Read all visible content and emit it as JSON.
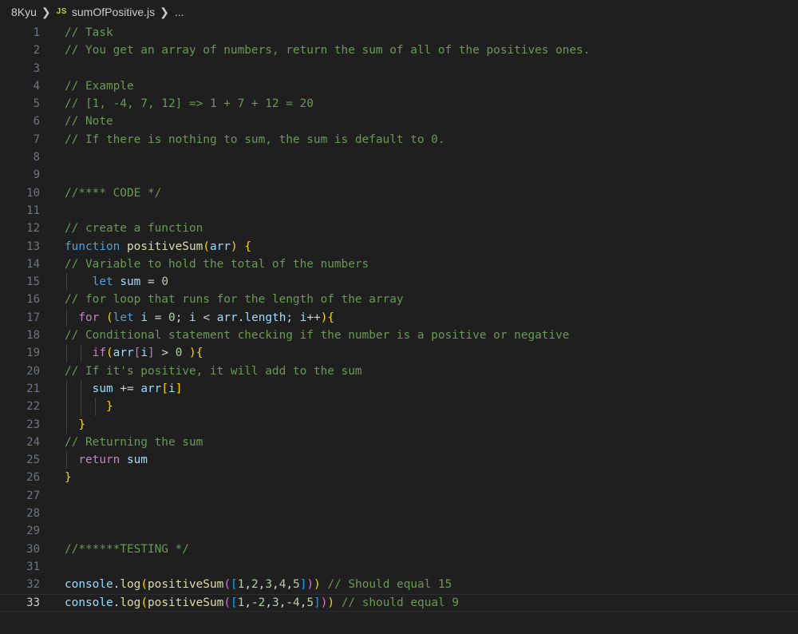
{
  "breadcrumb": {
    "folder": "8Kyu",
    "file_icon": "JS",
    "file_icon_color": "#cbcb41",
    "file": "sumOfPositive.js",
    "ellipsis": "..."
  },
  "editor": {
    "active_line": 33,
    "lines": [
      {
        "n": "1",
        "text": "// Task"
      },
      {
        "n": "2",
        "text": "// You get an array of numbers, return the sum of all of the positives ones."
      },
      {
        "n": "3",
        "text": ""
      },
      {
        "n": "4",
        "text": "// Example"
      },
      {
        "n": "5",
        "text": "// [1, -4, 7, 12] => 1 + 7 + 12 = 20"
      },
      {
        "n": "6",
        "text": "// Note"
      },
      {
        "n": "7",
        "text": "// If there is nothing to sum, the sum is default to 0."
      },
      {
        "n": "8",
        "text": ""
      },
      {
        "n": "9",
        "text": ""
      },
      {
        "n": "10",
        "text": "//**** CODE */"
      },
      {
        "n": "11",
        "text": ""
      },
      {
        "n": "12",
        "text": "// create a function"
      },
      {
        "n": "13",
        "text": "function positiveSum(arr) {"
      },
      {
        "n": "14",
        "text": "// Variable to hold the total of the numbers"
      },
      {
        "n": "15",
        "text": "    let sum = 0"
      },
      {
        "n": "16",
        "text": "// for loop that runs for the length of the array"
      },
      {
        "n": "17",
        "text": "  for (let i = 0; i < arr.length; i++){"
      },
      {
        "n": "18",
        "text": "// Conditional statement checking if the number is a positive or negative"
      },
      {
        "n": "19",
        "text": "    if(arr[i] > 0 ){"
      },
      {
        "n": "20",
        "text": "// If it's positive, it will add to the sum"
      },
      {
        "n": "21",
        "text": "    sum += arr[i]"
      },
      {
        "n": "22",
        "text": "      }"
      },
      {
        "n": "23",
        "text": "  }"
      },
      {
        "n": "24",
        "text": "// Returning the sum"
      },
      {
        "n": "25",
        "text": "  return sum"
      },
      {
        "n": "26",
        "text": "}"
      },
      {
        "n": "27",
        "text": ""
      },
      {
        "n": "28",
        "text": ""
      },
      {
        "n": "29",
        "text": ""
      },
      {
        "n": "30",
        "text": "//******TESTING */"
      },
      {
        "n": "31",
        "text": ""
      },
      {
        "n": "32",
        "text": "console.log(positiveSum([1,2,3,4,5])) // Should equal 15"
      },
      {
        "n": "33",
        "text": "console.log(positiveSum([1,-2,3,-4,5])) // should equal 9"
      }
    ]
  }
}
